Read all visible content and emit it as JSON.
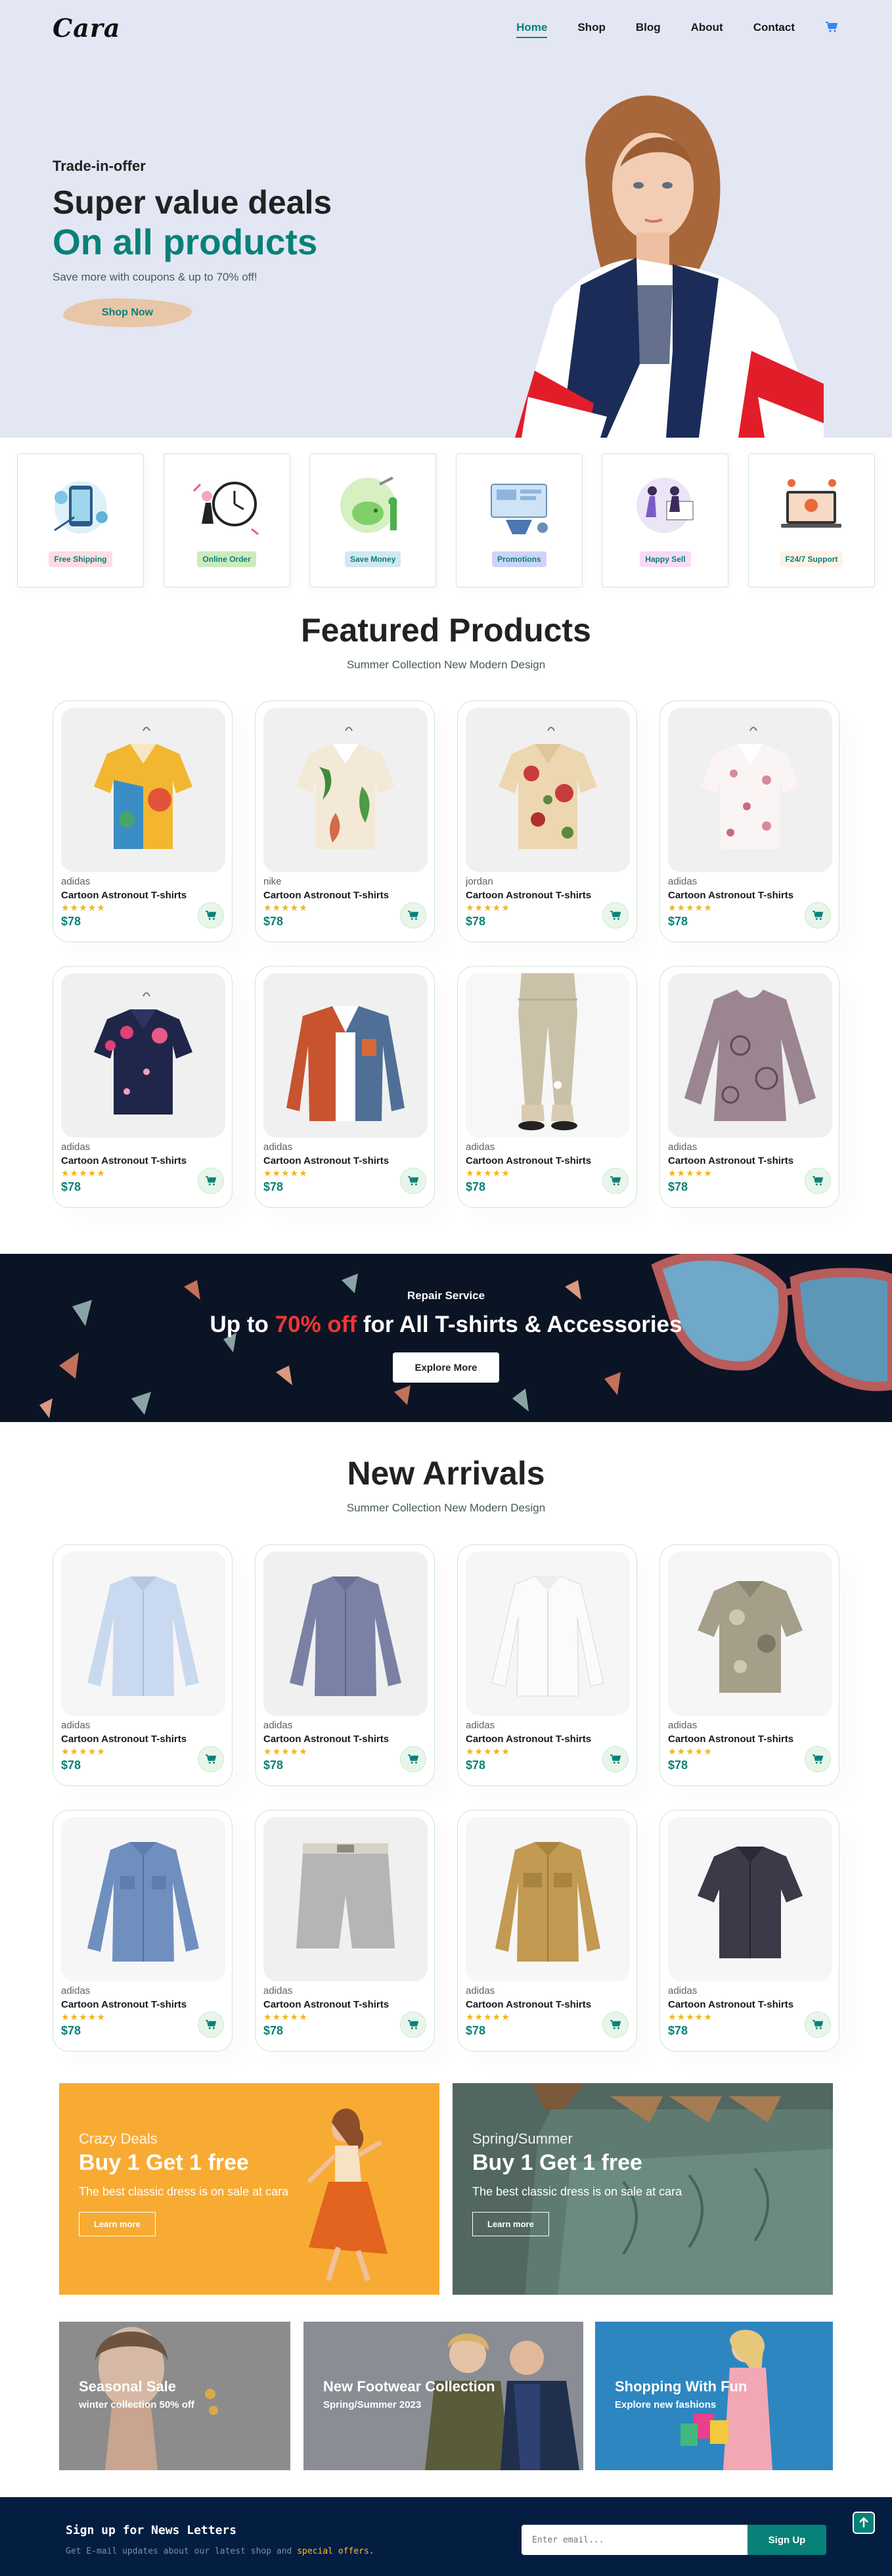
{
  "header": {
    "logo": "Cara",
    "nav": [
      {
        "label": "Home",
        "active": true
      },
      {
        "label": "Shop",
        "active": false
      },
      {
        "label": "Blog",
        "active": false
      },
      {
        "label": "About",
        "active": false
      },
      {
        "label": "Contact",
        "active": false
      }
    ],
    "cart_icon": "cart-icon"
  },
  "hero": {
    "eyebrow": "Trade-in-offer",
    "title": "Super value deals",
    "subtitle": "On all products",
    "text": "Save more with coupons & up to 70% off!",
    "button": "Shop Now"
  },
  "features": [
    {
      "label": "Free Shipping",
      "color": "#fddde4",
      "icon": "shipping-illustration"
    },
    {
      "label": "Online Order",
      "color": "#cdebbc",
      "icon": "online-order-illustration"
    },
    {
      "label": "Save Money",
      "color": "#d1e8f2",
      "icon": "save-money-illustration"
    },
    {
      "label": "Promotions",
      "color": "#cdd4f8",
      "icon": "promotions-illustration"
    },
    {
      "label": "Happy Sell",
      "color": "#f6dbf6",
      "icon": "happy-sell-illustration"
    },
    {
      "label": "F24/7 Support",
      "color": "#fff2e5",
      "icon": "support-illustration"
    }
  ],
  "featured": {
    "title": "Featured Products",
    "subtitle": "Summer Collection New Modern Design",
    "products": [
      {
        "brand": "adidas",
        "name": "Cartoon Astronout T-shirts",
        "stars": "★★★★★",
        "price": "$78"
      },
      {
        "brand": "nike",
        "name": "Cartoon Astronout T-shirts",
        "stars": "★★★★★",
        "price": "$78"
      },
      {
        "brand": "jordan",
        "name": "Cartoon Astronout T-shirts",
        "stars": "★★★★★",
        "price": "$78"
      },
      {
        "brand": "adidas",
        "name": "Cartoon Astronout T-shirts",
        "stars": "★★★★★",
        "price": "$78"
      },
      {
        "brand": "adidas",
        "name": "Cartoon Astronout T-shirts",
        "stars": "★★★★★",
        "price": "$78"
      },
      {
        "brand": "adidas",
        "name": "Cartoon Astronout T-shirts",
        "stars": "★★★★★",
        "price": "$78"
      },
      {
        "brand": "adidas",
        "name": "Cartoon Astronout T-shirts",
        "stars": "★★★★★",
        "price": "$78"
      },
      {
        "brand": "adidas",
        "name": "Cartoon Astronout T-shirts",
        "stars": "★★★★★",
        "price": "$78"
      }
    ]
  },
  "banner": {
    "eyebrow": "Repair Service",
    "title_pre": "Up to ",
    "title_highlight": "70% off",
    "title_post": " for All T-shirts & Accessories",
    "button": "Explore More"
  },
  "arrivals": {
    "title": "New Arrivals",
    "subtitle": "Summer Collection New Modern Design",
    "products": [
      {
        "brand": "adidas",
        "name": "Cartoon Astronout T-shirts",
        "stars": "★★★★★",
        "price": "$78"
      },
      {
        "brand": "adidas",
        "name": "Cartoon Astronout T-shirts",
        "stars": "★★★★★",
        "price": "$78"
      },
      {
        "brand": "adidas",
        "name": "Cartoon Astronout T-shirts",
        "stars": "★★★★★",
        "price": "$78"
      },
      {
        "brand": "adidas",
        "name": "Cartoon Astronout T-shirts",
        "stars": "★★★★★",
        "price": "$78"
      },
      {
        "brand": "adidas",
        "name": "Cartoon Astronout T-shirts",
        "stars": "★★★★★",
        "price": "$78"
      },
      {
        "brand": "adidas",
        "name": "Cartoon Astronout T-shirts",
        "stars": "★★★★★",
        "price": "$78"
      },
      {
        "brand": "adidas",
        "name": "Cartoon Astronout T-shirts",
        "stars": "★★★★★",
        "price": "$78"
      },
      {
        "brand": "adidas",
        "name": "Cartoon Astronout T-shirts",
        "stars": "★★★★★",
        "price": "$78"
      }
    ]
  },
  "sm_banners": [
    {
      "eyebrow": "Crazy Deals",
      "title": "Buy 1 Get 1 free",
      "text": "The best classic dress is on sale at cara",
      "button": "Learn more"
    },
    {
      "eyebrow": "Spring/Summer",
      "title": "Buy 1 Get 1 free",
      "text": "The best classic dress is on sale at cara",
      "button": "Learn more"
    }
  ],
  "banners3": [
    {
      "title": "Seasonal Sale",
      "text": "winter collection 50% off"
    },
    {
      "title": "New Footwear Collection",
      "text": "Spring/Summer 2023"
    },
    {
      "title": "Shopping With Fun",
      "text": "Explore new fashions"
    }
  ],
  "newsletter": {
    "title": "Sign up for News Letters",
    "text": "Get E-mail updates about our latest shop and ",
    "highlight": "special offers.",
    "placeholder": "Enter email...",
    "button": "Sign Up"
  },
  "colors": {
    "accent": "#088178",
    "hero_bg": "#e3e6f3",
    "star": "#f3b519",
    "banner_red": "#ef3636"
  }
}
